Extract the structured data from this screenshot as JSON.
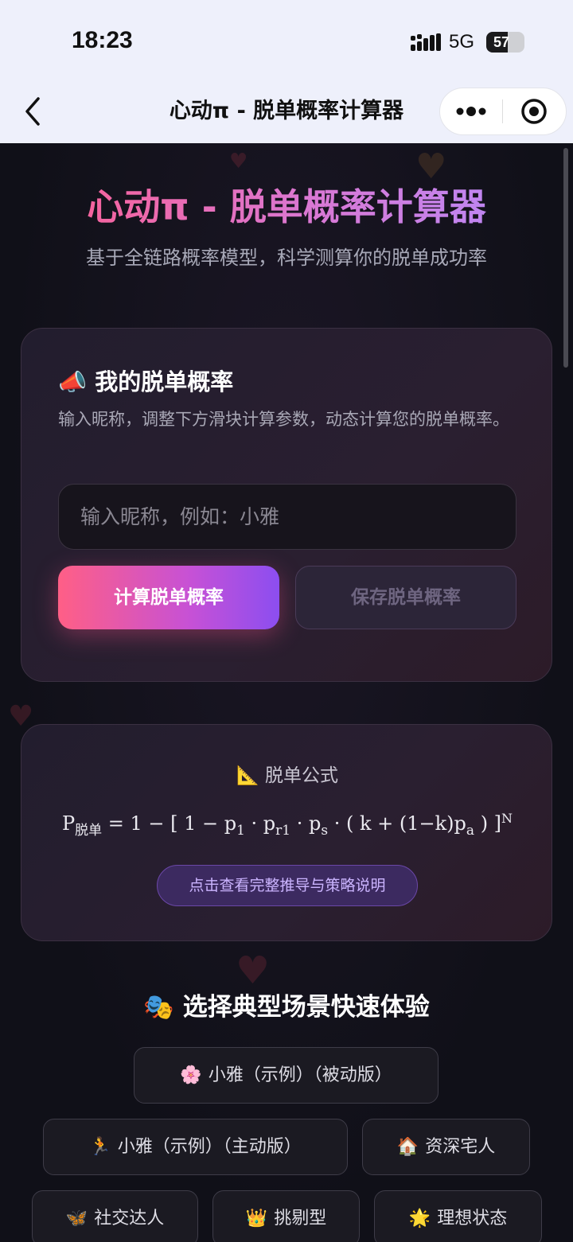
{
  "status_bar": {
    "time": "18:23",
    "network": "5G",
    "battery": "57",
    "battery_level": 0.57
  },
  "nav": {
    "title": "心动π - 脱单概率计算器"
  },
  "hero": {
    "title": "心动π - 脱单概率计算器",
    "subtitle": "基于全链路概率模型，科学测算你的脱单成功率"
  },
  "calc_card": {
    "icon": "📣",
    "title": "我的脱单概率",
    "description": "输入昵称，调整下方滑块计算参数，动态计算您的脱单概率。",
    "nickname_placeholder": "输入昵称，例如：小雅",
    "nickname_value": "",
    "calculate_label": "计算脱单概率",
    "save_label": "保存脱单概率"
  },
  "formula_card": {
    "icon": "📐",
    "heading": "脱单公式",
    "P": "P",
    "P_sub": "脱单",
    "eq_part1": " = 1 − [ 1 − p",
    "p1_sub": "1",
    "dot1": " · p",
    "pr1_sub": "r1",
    "dot2": " · p",
    "ps_sub": "s",
    "eq_part2": " · ( k + (1−k)p",
    "pa_sub": "a",
    "eq_part3": " ) ]",
    "exp": "N",
    "derive_label": "点击查看完整推导与策略说明"
  },
  "scenes": {
    "icon": "🎭",
    "title": "选择典型场景快速体验",
    "items": [
      {
        "icon": "🌸",
        "label": "小雅（示例）（被动版）"
      },
      {
        "icon": "🏃",
        "label": "小雅（示例）（主动版）"
      },
      {
        "icon": "🏠",
        "label": "资深宅人"
      },
      {
        "icon": "🦋",
        "label": "社交达人"
      },
      {
        "icon": "👑",
        "label": "挑剔型"
      },
      {
        "icon": "🌟",
        "label": "理想状态"
      }
    ]
  }
}
